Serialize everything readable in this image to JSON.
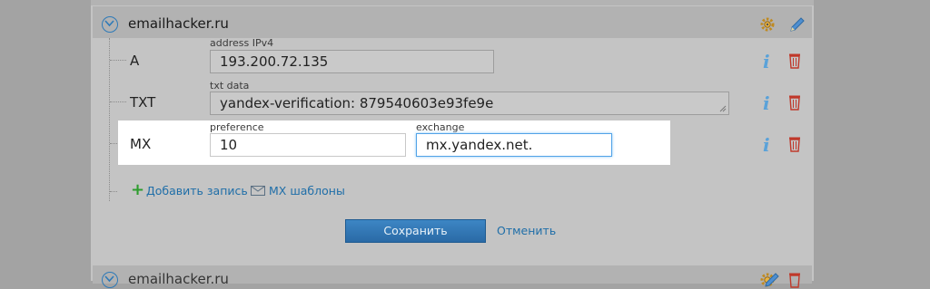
{
  "domain": {
    "name": "emailhacker.ru"
  },
  "next_domain": {
    "name": "emailhacker.ru"
  },
  "records": [
    {
      "type": "A",
      "field_label": "address IPv4",
      "value": "193.200.72.135"
    },
    {
      "type": "TXT",
      "field_label": "txt data",
      "value": "yandex-verification: 879540603e93fe9e"
    },
    {
      "type": "MX",
      "pref_label": "preference",
      "pref_value": "10",
      "exch_label": "exchange",
      "exch_value": "mx.yandex.net."
    }
  ],
  "actions": {
    "add_record": "Добавить запись",
    "mx_templates": "MX шаблоны",
    "save": "Сохранить",
    "cancel": "Отменить"
  },
  "icons": {
    "expand": "chevron-down-icon",
    "settings": "gear-icon",
    "edit": "pencil-icon",
    "info": "info-icon",
    "delete": "trash-icon",
    "add": "plus-icon",
    "templates": "envelope-icon"
  },
  "colors": {
    "link": "#1f6ea8",
    "save_button": "#3279b7",
    "add_plus": "#2e9d2e",
    "delete": "#c0392b",
    "focus_border": "#52a3e8"
  }
}
